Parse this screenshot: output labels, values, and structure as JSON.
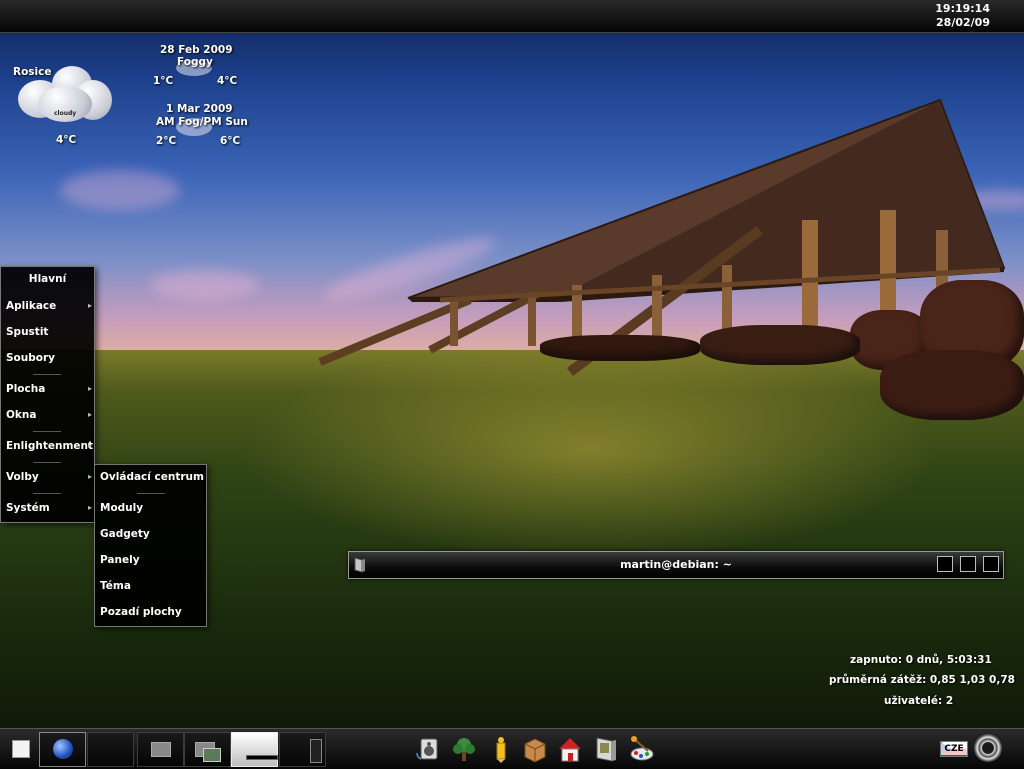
{
  "top_bar": {
    "time": "19:19:14",
    "date": "28/02/09"
  },
  "weather": {
    "location": "Rosice",
    "icon": "cloudy-icon",
    "icon_label": "cloudy",
    "current_temp": "4°C",
    "forecast": [
      {
        "date": "28 Feb 2009",
        "condition": "Foggy",
        "low": "1°C",
        "high": "4°C"
      },
      {
        "date": "1 Mar 2009",
        "condition": "AM Fog/PM Sun",
        "low": "2°C",
        "high": "6°C"
      }
    ]
  },
  "main_menu": {
    "title": "Hlavní",
    "items": [
      {
        "label": "Aplikace",
        "submenu": true
      },
      {
        "label": "Spustit",
        "submenu": false
      },
      {
        "label": "Soubory",
        "submenu": false
      },
      {
        "label": "Plocha",
        "submenu": true
      },
      {
        "label": "Okna",
        "submenu": true
      },
      {
        "label": "Enlightenment",
        "submenu": true
      },
      {
        "label": "Volby",
        "submenu": true
      },
      {
        "label": "Systém",
        "submenu": true
      }
    ]
  },
  "options_submenu": {
    "items": [
      {
        "label": "Ovládací centrum"
      },
      {
        "label": "Moduly"
      },
      {
        "label": "Gadgety"
      },
      {
        "label": "Panely"
      },
      {
        "label": "Téma"
      },
      {
        "label": "Pozadí plochy"
      }
    ]
  },
  "terminal": {
    "title": "martin@debian: ~"
  },
  "system_info": {
    "uptime": "zapnuto: 0 dnů, 5:03:31",
    "load": "průměrná zátěž: 0,85 1,03 0,78",
    "users": "uživatelé: 2"
  },
  "shelf": {
    "keyboard_layout": "CZE",
    "launchers": [
      "speaker-icon",
      "tree-icon",
      "pencil-icon",
      "package-icon",
      "home-icon",
      "file-manager-icon",
      "paint-icon"
    ],
    "colors": {
      "panel": "#0a0a0a",
      "home_red": "#d02020",
      "package_tan": "#c88a4a",
      "pencil_yellow": "#f0c020"
    }
  }
}
